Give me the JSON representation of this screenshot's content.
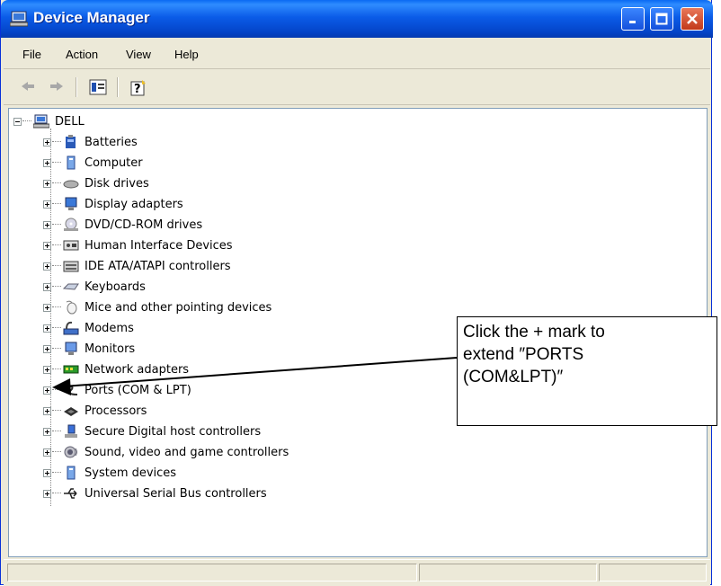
{
  "window": {
    "title": "Device Manager",
    "accent": "#0b5ce8"
  },
  "menu": {
    "items": [
      "File",
      "Action",
      "View",
      "Help"
    ]
  },
  "toolbar": {
    "icons": [
      "back-arrow-icon",
      "forward-arrow-icon",
      "properties-icon",
      "help-icon"
    ]
  },
  "tree": {
    "root": "DELL",
    "items": [
      {
        "label": "Batteries",
        "icon": "battery-icon"
      },
      {
        "label": "Computer",
        "icon": "computer-icon"
      },
      {
        "label": "Disk drives",
        "icon": "disk-drive-icon"
      },
      {
        "label": "Display adapters",
        "icon": "display-adapter-icon"
      },
      {
        "label": "DVD/CD-ROM drives",
        "icon": "dvd-drive-icon"
      },
      {
        "label": "Human Interface Devices",
        "icon": "hid-icon"
      },
      {
        "label": "IDE ATA/ATAPI controllers",
        "icon": "ide-controller-icon"
      },
      {
        "label": "Keyboards",
        "icon": "keyboard-icon"
      },
      {
        "label": "Mice and other pointing devices",
        "icon": "mouse-icon"
      },
      {
        "label": "Modems",
        "icon": "modem-icon"
      },
      {
        "label": "Monitors",
        "icon": "monitor-icon"
      },
      {
        "label": "Network adapters",
        "icon": "network-adapter-icon"
      },
      {
        "label": "Ports (COM & LPT)",
        "icon": "port-icon"
      },
      {
        "label": "Processors",
        "icon": "processor-icon"
      },
      {
        "label": "Secure Digital host controllers",
        "icon": "sd-controller-icon"
      },
      {
        "label": "Sound, video and game controllers",
        "icon": "sound-icon"
      },
      {
        "label": "System devices",
        "icon": "system-device-icon"
      },
      {
        "label": "Universal Serial Bus controllers",
        "icon": "usb-icon"
      }
    ]
  },
  "callout": {
    "lines": [
      "Click the + mark to",
      "extend ″PORTS",
      "(COM&LPT)″"
    ]
  }
}
